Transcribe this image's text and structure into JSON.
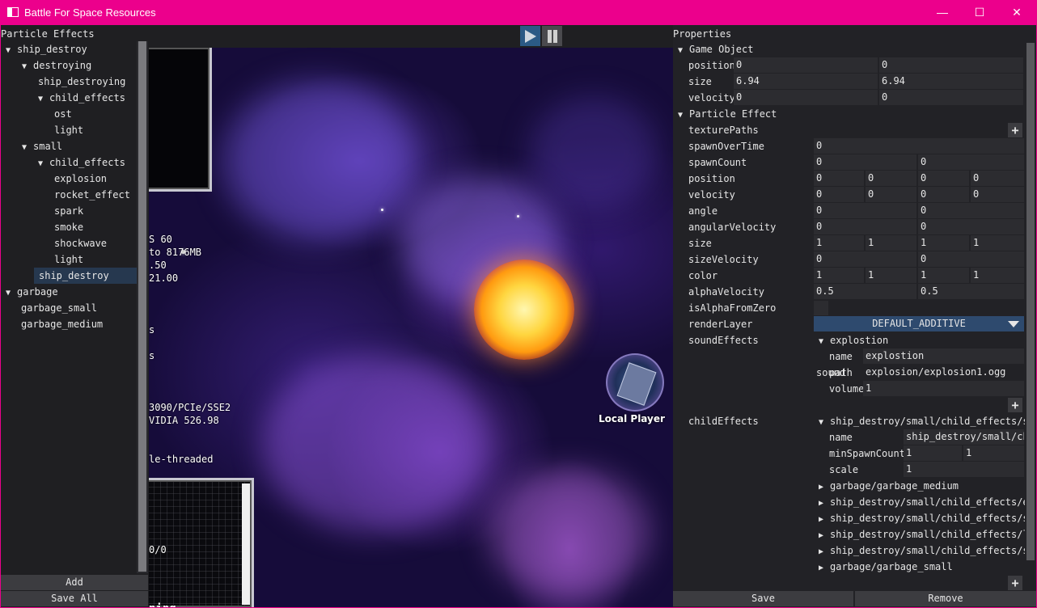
{
  "window": {
    "title": "Battle For Space Resources",
    "minimize": "—",
    "maximize": "☐",
    "close": "✕"
  },
  "left_panel": {
    "title": "Particle Effects",
    "tree": [
      {
        "label": "ship_destroy",
        "arrow": "▼"
      },
      {
        "label": "destroying",
        "arrow": "▼"
      },
      {
        "label": "ship_destroying",
        "arrow": ""
      },
      {
        "label": "child_effects",
        "arrow": "▼"
      },
      {
        "label": "ost",
        "arrow": ""
      },
      {
        "label": "light",
        "arrow": ""
      },
      {
        "label": "small",
        "arrow": "▼"
      },
      {
        "label": "child_effects",
        "arrow": "▼"
      },
      {
        "label": "explosion",
        "arrow": ""
      },
      {
        "label": "rocket_effect",
        "arrow": ""
      },
      {
        "label": "spark",
        "arrow": ""
      },
      {
        "label": "smoke",
        "arrow": ""
      },
      {
        "label": "shockwave",
        "arrow": ""
      },
      {
        "label": "light",
        "arrow": ""
      },
      {
        "label": "ship_destroy",
        "arrow": ""
      },
      {
        "label": "garbage",
        "arrow": "▼"
      },
      {
        "label": "garbage_small",
        "arrow": ""
      },
      {
        "label": "garbage_medium",
        "arrow": ""
      }
    ],
    "add_label": "Add",
    "save_all_label": "Save All"
  },
  "viewport": {
    "hud_lines": [
      "S 60",
      " to 8176MB",
      ".50",
      "21.00",
      "s",
      "s",
      " 3090/PCIe/SSE2",
      "VIDIA 526.98",
      "le-threaded",
      "0/0",
      "ning"
    ],
    "player_label": "Local Player"
  },
  "right_panel": {
    "title": "Properties",
    "game_object": {
      "header": "Game Object",
      "arrow": "▼",
      "position_label": "position",
      "position": [
        "0",
        "0"
      ],
      "size_label": "size",
      "size": [
        "6.94",
        "6.94"
      ],
      "velocity_label": "velocity",
      "velocity": [
        "0",
        "0"
      ]
    },
    "particle_effect": {
      "header": "Particle Effect",
      "arrow": "▼",
      "texture_paths_label": "texturePaths",
      "spawn_over_time_label": "spawnOverTime",
      "spawn_over_time": "0",
      "spawn_count_label": "spawnCount",
      "spawn_count": [
        "0",
        "0"
      ],
      "position_label": "position",
      "position": [
        "0",
        "0",
        "0",
        "0"
      ],
      "velocity_label": "velocity",
      "velocity": [
        "0",
        "0",
        "0",
        "0"
      ],
      "angle_label": "angle",
      "angle": [
        "0",
        "0"
      ],
      "angular_velocity_label": "angularVelocity",
      "angular_velocity": [
        "0",
        "0"
      ],
      "size_label": "size",
      "size": [
        "1",
        "1",
        "1",
        "1"
      ],
      "size_velocity_label": "sizeVelocity",
      "size_velocity": [
        "0",
        "0"
      ],
      "color_label": "color",
      "color": [
        "1",
        "1",
        "1",
        "1"
      ],
      "alpha_velocity_label": "alphaVelocity",
      "alpha_velocity": [
        "0.5",
        "0.5"
      ],
      "is_alpha_from_zero_label": "isAlphaFromZero",
      "is_alpha_from_zero": false,
      "render_layer_label": "renderLayer",
      "render_layer": "DEFAULT_ADDITIVE",
      "sound_effects_label": "soundEffects",
      "sound_effect": {
        "arrow": "▼",
        "header": "explostion",
        "name_label": "name",
        "name": "explostion",
        "sound_label": "sound",
        "path_label": "path",
        "path": "explosion/explosion1.ogg",
        "volume_label": "volume",
        "volume": "1"
      },
      "child_effects_label": "childEffects",
      "child_effects": [
        {
          "arrow": "▼",
          "header": "ship_destroy/small/child_effects/sh",
          "name_label": "name",
          "name": "ship_destroy/small/ch",
          "min_spawn_count_label": "minSpawnCount",
          "min_spawn_count": [
            "1",
            "1"
          ],
          "scale_label": "scale",
          "scale": "1"
        },
        {
          "arrow": "▶",
          "header": "garbage/garbage_medium"
        },
        {
          "arrow": "▶",
          "header": "ship_destroy/small/child_effects/e:"
        },
        {
          "arrow": "▶",
          "header": "ship_destroy/small/child_effects/sp"
        },
        {
          "arrow": "▶",
          "header": "ship_destroy/small/child_effects/li"
        },
        {
          "arrow": "▶",
          "header": "ship_destroy/small/child_effects/sm"
        },
        {
          "arrow": "▶",
          "header": "garbage/garbage_small"
        }
      ],
      "plus": "+"
    },
    "save_label": "Save",
    "remove_label": "Remove"
  }
}
